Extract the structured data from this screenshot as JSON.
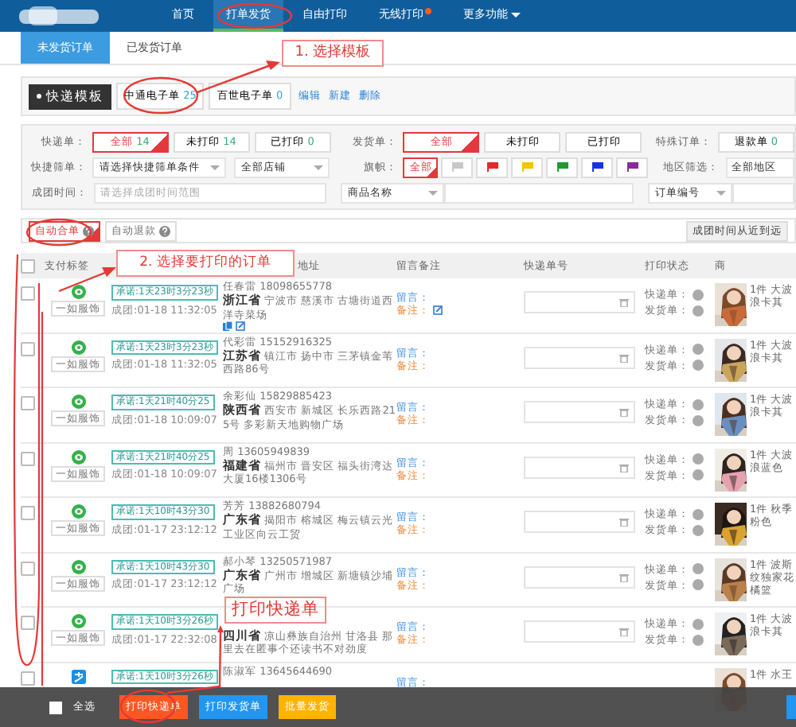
{
  "nav": {
    "items": [
      {
        "label": "首页",
        "selected": false
      },
      {
        "label": "打单发货",
        "selected": true
      },
      {
        "label": "自由打印",
        "selected": false
      },
      {
        "label": "无线打印",
        "selected": false,
        "badge": true
      },
      {
        "label": "更多功能",
        "selected": false,
        "dropdown": true
      }
    ]
  },
  "subtabs": [
    {
      "label": "未发货订单",
      "selected": true
    },
    {
      "label": "已发货订单",
      "selected": false
    }
  ],
  "template_bar": {
    "title": "快递模板",
    "templates": [
      {
        "label": "中通电子单",
        "count": "25"
      },
      {
        "label": "百世电子单",
        "count": "0"
      }
    ],
    "actions": [
      "编辑",
      "新建",
      "删除"
    ]
  },
  "filters": {
    "express": {
      "label": "快递单：",
      "options": [
        {
          "label": "全部",
          "count": "14",
          "selected": true
        },
        {
          "label": "未打印",
          "count": "14",
          "selected": false
        },
        {
          "label": "已打印",
          "count": "0",
          "selected": false
        }
      ]
    },
    "invoice": {
      "label": "发货单：",
      "options": [
        {
          "label": "全部",
          "selected": true
        },
        {
          "label": "未打印",
          "selected": false
        },
        {
          "label": "已打印",
          "selected": false
        }
      ]
    },
    "special": {
      "label": "特殊订单：",
      "options": [
        {
          "label": "退款单",
          "count": "0",
          "selected": false
        }
      ]
    },
    "quick": {
      "label": "快捷筛单：",
      "selects": [
        "请选择快捷筛单条件",
        "全部店铺"
      ]
    },
    "flags": {
      "label": "旗帜：",
      "all": {
        "label": "全部",
        "selected": true
      },
      "items": [
        {
          "color": "#c8c8c8",
          "selected": false
        },
        {
          "color": "#e8262b",
          "selected": false
        },
        {
          "color": "#f5c400",
          "selected": false
        },
        {
          "color": "#1f9a2e",
          "selected": false
        },
        {
          "color": "#1733e0",
          "selected": false
        },
        {
          "color": "#8a2a9a",
          "selected": false
        }
      ]
    },
    "region": {
      "label": "地区筛选：",
      "value": "全部地区"
    },
    "time": {
      "label": "成团时间：",
      "placeholder": "请选择成团时间范围"
    },
    "product": {
      "select": "商品名称"
    },
    "order": {
      "select": "订单编号"
    }
  },
  "toggles": [
    {
      "label": "自动合单",
      "selected": true
    },
    {
      "label": "自动退款",
      "selected": false
    }
  ],
  "sort": "成团时间从近到远",
  "table": {
    "header_checkbox": {
      "checked": false
    },
    "columns": [
      "支付标签",
      "地址",
      "留言备注",
      "快递单号",
      "打印状态",
      "商"
    ],
    "rows": [
      {
        "kind": "wechat",
        "checked": false,
        "shop": "一如服饰",
        "promise": "承诺:1天23时3分23秒",
        "formed": "成团:01-18 11:32:05",
        "contact": "任春雷 18098655778",
        "province": "浙江省",
        "address": "宁波市 慈溪市 古塘街道西洋寺菜场",
        "address_icons": true,
        "message": "留言：",
        "remark": "备注：",
        "remark_edit": true,
        "status": [
          {
            "label": "快递单：",
            "printed": false
          },
          {
            "label": "发货单：",
            "printed": false
          }
        ],
        "product": "1件 大波浪卡其"
      },
      {
        "kind": "wechat",
        "checked": false,
        "shop": "一如服饰",
        "promise": "承诺:1天23时3分23秒",
        "formed": "成团:01-18 11:32:05",
        "contact": "代彩雷 15152916325",
        "province": "江苏省",
        "address": "镇江市 扬中市 三茅镇金苇西路86号",
        "message": "留言：",
        "remark": "备注：",
        "status": [
          {
            "label": "快递单：",
            "printed": false
          },
          {
            "label": "发货单：",
            "printed": false
          }
        ],
        "product": "1件 大波浪卡其"
      },
      {
        "kind": "wechat",
        "checked": false,
        "shop": "一如服饰",
        "promise": "承诺:1天21时40分25",
        "formed": "成团:01-18 10:09:07",
        "contact": "余彩仙 15829885423",
        "province": "陕西省",
        "address": "西安市 新城区 长乐西路215号 多彩新天地购物广场",
        "message": "留言：",
        "remark": "备注：",
        "status": [
          {
            "label": "快递单：",
            "printed": false
          },
          {
            "label": "发货单：",
            "printed": false
          }
        ],
        "product": "1件 大波浪卡其"
      },
      {
        "kind": "wechat",
        "checked": false,
        "shop": "一如服饰",
        "promise": "承诺:1天21时40分25",
        "formed": "成团:01-18 10:09:07",
        "contact": "周 13605949839",
        "province": "福建省",
        "address": "福州市 晋安区 福头街湾达大厦16楼1306号",
        "message": "留言：",
        "remark": "备注：",
        "status": [
          {
            "label": "快递单：",
            "printed": false
          },
          {
            "label": "发货单：",
            "printed": false
          }
        ],
        "product": "1件 大波浪蓝色"
      },
      {
        "kind": "wechat",
        "checked": false,
        "shop": "一如服饰",
        "promise": "承诺:1天10时43分30",
        "formed": "成团:01-17 23:12:12",
        "contact": "芳芳 13882680794",
        "province": "广东省",
        "address": "揭阳市 榕城区 梅云镇云光工业区向云工贸",
        "message": "留言：",
        "remark": "备注：",
        "status": [
          {
            "label": "快递单：",
            "printed": false
          },
          {
            "label": "发货单：",
            "printed": false
          }
        ],
        "product": "1件 秋季粉色"
      },
      {
        "kind": "wechat",
        "checked": false,
        "shop": "一如服饰",
        "promise": "承诺:1天10时43分30",
        "formed": "成团:01-17 23:12:12",
        "contact": "郝小琴 13250571987",
        "province": "广东省",
        "address": "广州市 增城区 新塘镇沙埔广场",
        "message": "留言：",
        "remark": "备注：",
        "status": [
          {
            "label": "快递单：",
            "printed": false
          },
          {
            "label": "发货单：",
            "printed": false
          }
        ],
        "product": "1件 波斯纹独家花橘篮"
      },
      {
        "kind": "wechat",
        "checked": false,
        "shop": "一如服饰",
        "promise": "承诺:1天10时3分26秒",
        "formed": "成团:01-17 22:32:08",
        "province": "四川省",
        "address": "凉山彝族自治州 甘洛县 那里去在匿事个还读书不对劲度",
        "message": "留言：",
        "remark": "备注：",
        "status": [
          {
            "label": "快递单：",
            "printed": false
          },
          {
            "label": "发货单：",
            "printed": false
          }
        ],
        "product": "1件 大波浪卡其"
      },
      {
        "kind": "alipay",
        "checked": false,
        "promise": "承诺:1天10时3分26秒",
        "contact": "陈淑军 13645644690",
        "message": "留言：",
        "product": "1件 水王"
      }
    ]
  },
  "bottom_bar": {
    "select_all": {
      "label": "全选",
      "checked": false
    },
    "buttons": [
      {
        "label": "打印快递单",
        "kind": "orange"
      },
      {
        "label": "打印发货单",
        "kind": "blue"
      },
      {
        "label": "批量发货",
        "kind": "yellow"
      },
      {
        "kind": "edge"
      }
    ]
  },
  "annotations": [
    {
      "text": "1. 选择模板",
      "kind": "step1"
    },
    {
      "text": "2. 选择要打印的订单",
      "kind": "step2"
    },
    {
      "text": "打印快递单",
      "kind": "step3"
    }
  ]
}
